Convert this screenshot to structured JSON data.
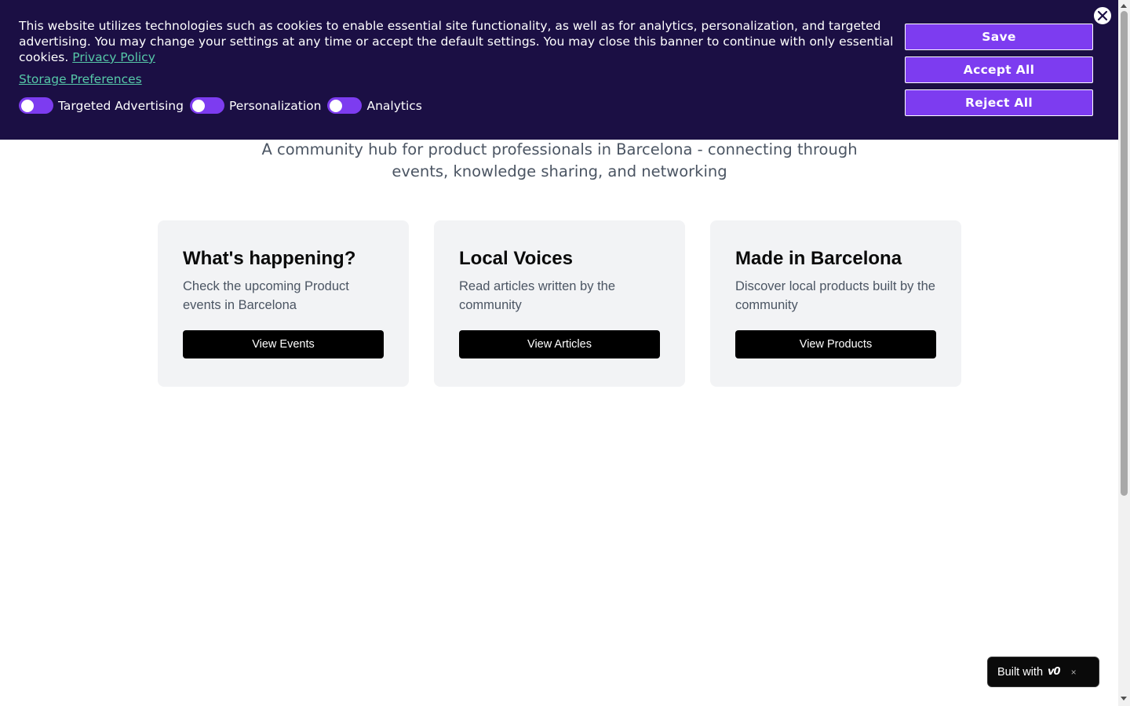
{
  "cookie_banner": {
    "text": "This website utilizes technologies such as cookies to enable essential site functionality, as well as for analytics, personalization, and targeted advertising. You may change your settings at any time or accept the default settings. You may close this banner to continue with only essential cookies.",
    "privacy_link": "Privacy Policy",
    "storage_link": "Storage Preferences",
    "toggles": [
      {
        "label": "Targeted Advertising",
        "enabled": false
      },
      {
        "label": "Personalization",
        "enabled": false
      },
      {
        "label": "Analytics",
        "enabled": false
      }
    ],
    "buttons": {
      "save": "Save",
      "accept_all": "Accept All",
      "reject_all": "Reject All"
    },
    "close_icon": "close-circle-icon"
  },
  "hero": {
    "subtitle": "A community hub for product professionals in Barcelona - connecting through events, knowledge sharing, and networking"
  },
  "cards": [
    {
      "title": "What's happening?",
      "description": "Check the upcoming Product events in Barcelona",
      "button": "View Events"
    },
    {
      "title": "Local Voices",
      "description": "Read articles written by the community",
      "button": "View Articles"
    },
    {
      "title": "Made in Barcelona",
      "description": "Discover local products built by the community",
      "button": "View Products"
    }
  ],
  "badge": {
    "text": "Built with",
    "logo": "v0",
    "close": "×"
  },
  "colors": {
    "banner_bg": "#1b0f44",
    "accent": "#7d3cf0",
    "link": "#56c8a8",
    "card_bg": "#f2f3f5"
  }
}
